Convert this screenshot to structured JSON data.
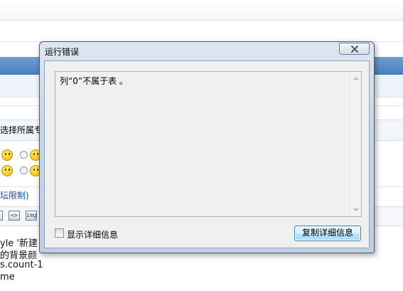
{
  "background": {
    "select_label": "选择所属专",
    "link_text": "坛限制)",
    "code_lines": [
      "yle '新建",
      "的背景颜",
      "s.count-1",
      "me"
    ],
    "toolbar_icons": [
      "<>",
      "img"
    ]
  },
  "dialog": {
    "title": "运行错误",
    "close_icon": "close-icon",
    "message": "列“0”不属于表 。",
    "show_details_label": "显示详细信息",
    "show_details_checked": false,
    "copy_button_label": "复制详细信息"
  },
  "colors": {
    "dialog_frame": "#c7d6e6",
    "header_band": "#4d80bd",
    "button_border": "#3c7fb1"
  }
}
